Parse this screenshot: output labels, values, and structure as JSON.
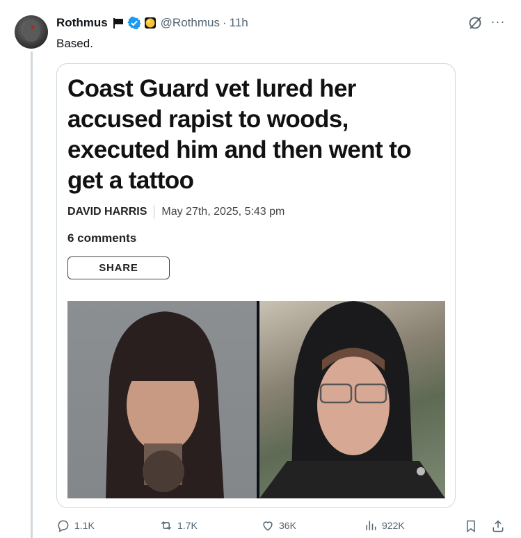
{
  "tweet": {
    "author_name": "Rothmus",
    "handle": "@Rothmus",
    "separator": "·",
    "time": "11h",
    "text": "Based."
  },
  "article_card": {
    "headline": "Coast Guard vet lured her accused rapist to woods, executed him and then went to get a tattoo",
    "author": "DAVID HARRIS",
    "date": "May 27th, 2025, 5:43 pm",
    "comments": "6 comments",
    "share_label": "SHARE"
  },
  "stats": {
    "replies": "1.1K",
    "reposts": "1.7K",
    "likes": "36K",
    "views": "922K"
  },
  "icons": {
    "header": [
      "flag-icon",
      "verified-icon",
      "affiliate-badge-icon",
      "grok-icon",
      "more-icon"
    ],
    "actions": [
      "reply-icon",
      "repost-icon",
      "like-icon",
      "views-icon",
      "bookmark-icon",
      "share-icon"
    ]
  },
  "colors": {
    "text_primary": "#0f1419",
    "text_secondary": "#536471",
    "verified_blue": "#1d9bf0",
    "affiliate_gold": "#f7c531",
    "border": "#cfd9de"
  }
}
